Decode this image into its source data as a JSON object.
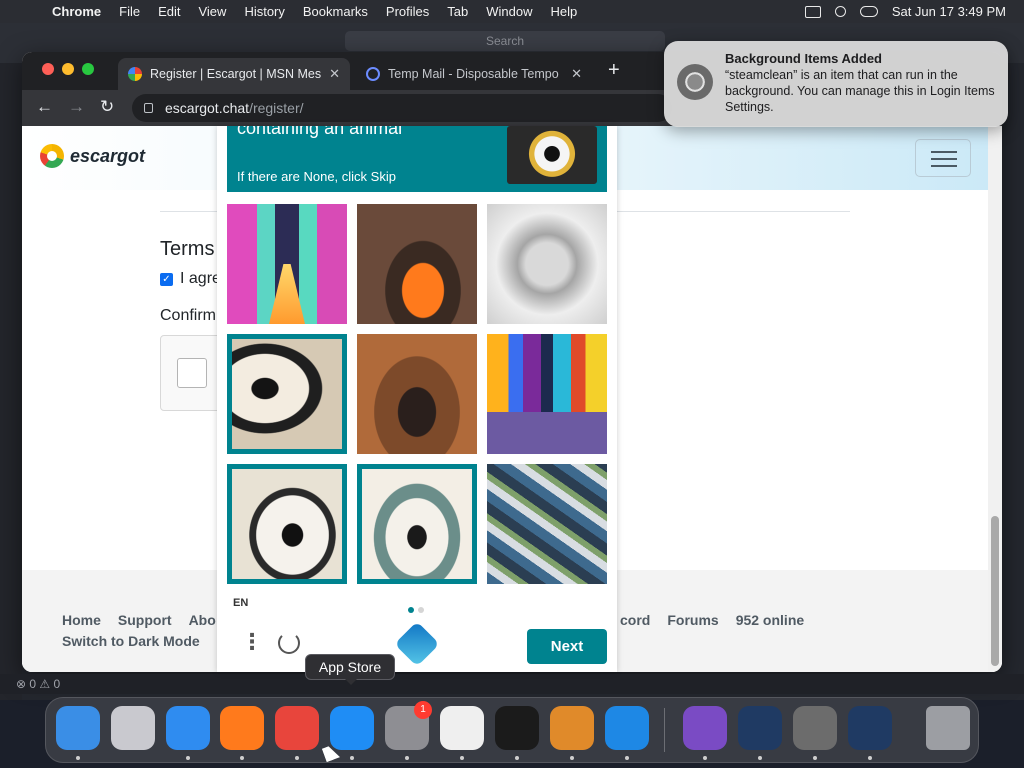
{
  "menubar": {
    "app": "Chrome",
    "items": [
      "File",
      "Edit",
      "View",
      "History",
      "Bookmarks",
      "Profiles",
      "Tab",
      "Window",
      "Help"
    ],
    "datetime": "Sat Jun 17  3:49 PM"
  },
  "background_window": {
    "search_placeholder": "Search"
  },
  "browser": {
    "tabs": [
      {
        "title": "Register | Escargot | MSN Mess",
        "favicon": "escargot-icon",
        "active": true
      },
      {
        "title": "Temp Mail - Disposable Tempo",
        "favicon": "tempmail-icon",
        "active": false
      }
    ],
    "url_host": "escargot.chat",
    "url_path": "/register/"
  },
  "page": {
    "logo": "escargot",
    "terms_heading": "Terms",
    "agree_text": "I agre",
    "agree_checked": true,
    "confirm_heading": "Confirm",
    "footer": {
      "links_left": [
        "Home",
        "Support",
        "Abo"
      ],
      "links_right": [
        "cord",
        "Forums",
        "952 online"
      ],
      "dark_mode": "Switch to Dark Mode"
    }
  },
  "captcha": {
    "prompt_title": "containing an animal",
    "prompt_subtitle": "If there are None, click Skip",
    "tiles": [
      {
        "subject": "neon hallway",
        "selected": false
      },
      {
        "subject": "orange car",
        "selected": false
      },
      {
        "subject": "blurry statue",
        "selected": false
      },
      {
        "subject": "panda on bed",
        "selected": true
      },
      {
        "subject": "car under tree",
        "selected": false
      },
      {
        "subject": "rainbow hallway",
        "selected": false
      },
      {
        "subject": "panda lying",
        "selected": true
      },
      {
        "subject": "panda sleeping",
        "selected": true
      },
      {
        "subject": "aerial city",
        "selected": false
      }
    ],
    "language": "EN",
    "page_dots": 2,
    "next_label": "Next"
  },
  "notification": {
    "title": "Background Items Added",
    "body": "“steamclean” is an item that can run in the background. You can manage this in Login Items Settings."
  },
  "status": {
    "problems": "⊗ 0 ⚠ 0"
  },
  "dock": {
    "tooltip": "App Store",
    "badge": "1",
    "apps": [
      {
        "name": "finder-icon",
        "color": "#3a8ee6"
      },
      {
        "name": "launchpad-icon",
        "color": "#c9c9cf"
      },
      {
        "name": "safari-icon",
        "color": "#2f8cf0"
      },
      {
        "name": "firefox-icon",
        "color": "#ff7a1c"
      },
      {
        "name": "chrome-icon",
        "color": "#e8453c"
      },
      {
        "name": "app-store-icon",
        "color": "#1f8df5"
      },
      {
        "name": "system-settings-icon",
        "color": "#8e8e93"
      },
      {
        "name": "textedit-icon",
        "color": "#efefef"
      },
      {
        "name": "terminal-icon",
        "color": "#1b1b1b"
      },
      {
        "name": "garageband-icon",
        "color": "#e08a2a"
      },
      {
        "name": "vscode-icon",
        "color": "#1e88e5"
      },
      {
        "name": "visual-studio-icon",
        "color": "#7a4bc4"
      },
      {
        "name": "steam-icon",
        "color": "#1f3a63"
      },
      {
        "name": "chess-icon",
        "color": "#6c6c6c"
      },
      {
        "name": "steam-icon-2",
        "color": "#1f3a63"
      },
      {
        "name": "trash-icon",
        "color": "#9c9ea3"
      }
    ]
  }
}
